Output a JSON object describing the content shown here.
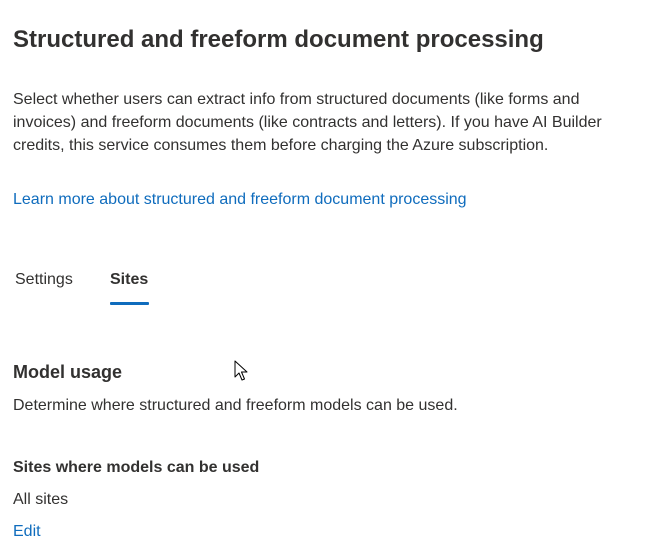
{
  "page": {
    "title": "Structured and freeform document processing",
    "description": "Select whether users can extract info from structured documents (like forms and invoices) and freeform documents (like contracts and letters). If you have AI Builder credits, this service consumes them before charging the Azure subscription.",
    "learn_more_link": "Learn more about structured and freeform document processing"
  },
  "tabs": [
    {
      "label": "Settings",
      "selected": false
    },
    {
      "label": "Sites",
      "selected": true
    }
  ],
  "model_usage": {
    "heading": "Model usage",
    "description": "Determine where structured and freeform models can be used.",
    "sites_label": "Sites where models can be used",
    "sites_value": "All sites",
    "edit_label": "Edit"
  },
  "colors": {
    "text": "#323130",
    "link": "#0f6cbd",
    "tab_indicator": "#0f6cbd",
    "background": "#ffffff"
  },
  "icons": {
    "cursor": "mouse-pointer-icon"
  }
}
